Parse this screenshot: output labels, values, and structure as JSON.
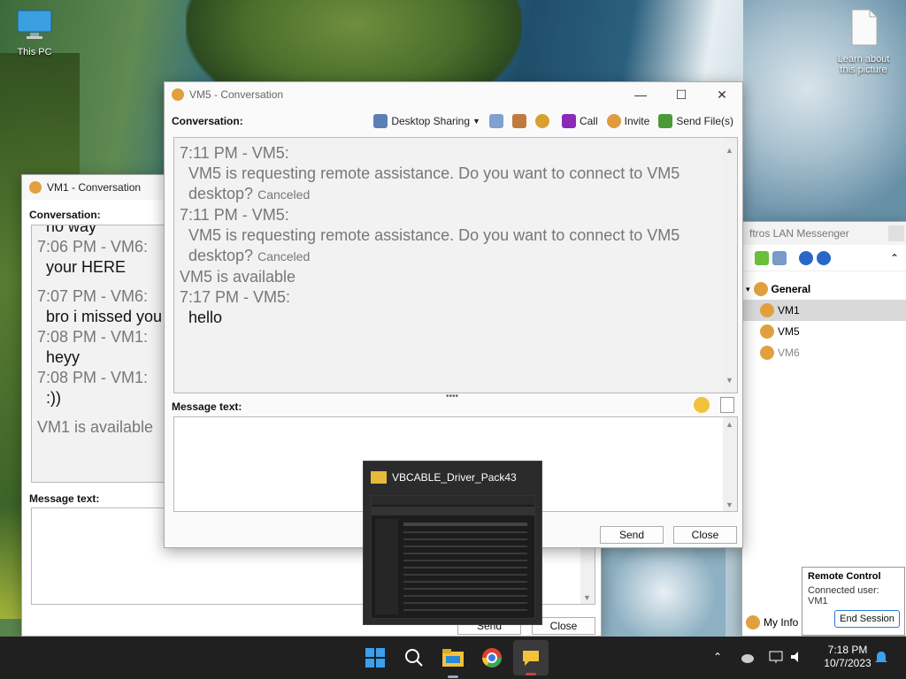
{
  "desktop": {
    "this_pc": "This PC",
    "learn": "Learn about this picture"
  },
  "vm5": {
    "title": "VM5 - Conversation",
    "conversation_label": "Conversation:",
    "toolbar": {
      "desktop_sharing": "Desktop Sharing",
      "call": "Call",
      "invite": "Invite",
      "send_files": "Send File(s)"
    },
    "messages": [
      {
        "time": "7:11 PM - VM5:",
        "text": "VM5 is requesting remote assistance. Do you want to connect to VM5 desktop?",
        "status": "Canceled"
      },
      {
        "time": "7:11 PM - VM5:",
        "text": "VM5 is requesting remote assistance. Do you want to connect to VM5 desktop?",
        "status": "Canceled"
      },
      {
        "system": "VM5 is available"
      },
      {
        "time": "7:17 PM - VM5:",
        "text": "hello"
      }
    ],
    "message_text_label": "Message text:",
    "send": "Send",
    "close": "Close"
  },
  "vm1": {
    "title": "VM1 - Conversation",
    "conversation_label": "Conversation:",
    "messages": [
      {
        "text": "no way"
      },
      {
        "time": "7:06 PM - VM6:",
        "text": "your HERE"
      },
      {
        "time": "7:07 PM - VM6:",
        "text": "bro i missed you"
      },
      {
        "time": "7:08 PM - VM1:",
        "text": "heyy"
      },
      {
        "time": "7:08 PM - VM1:",
        "text": ":))"
      },
      {
        "system": "VM1 is available"
      }
    ],
    "message_text_label": "Message text:",
    "send": "Send",
    "close": "Close"
  },
  "messenger": {
    "title": "ftros LAN Messenger",
    "group": "General",
    "users": [
      "VM1",
      "VM5",
      "VM6"
    ],
    "my_info": "My Info"
  },
  "thumbnail": {
    "title": "VBCABLE_Driver_Pack43"
  },
  "remote_control": {
    "title": "Remote Control",
    "connected": "Connected user: VM1",
    "end_session": "End Session"
  },
  "taskbar": {
    "time": "7:18 PM",
    "date": "10/7/2023"
  },
  "colors": {
    "taskbar": "#202020",
    "window_bg": "#ffffff",
    "pane_bg": "#f2f2f2",
    "selected_row": "#d9d9d9"
  }
}
